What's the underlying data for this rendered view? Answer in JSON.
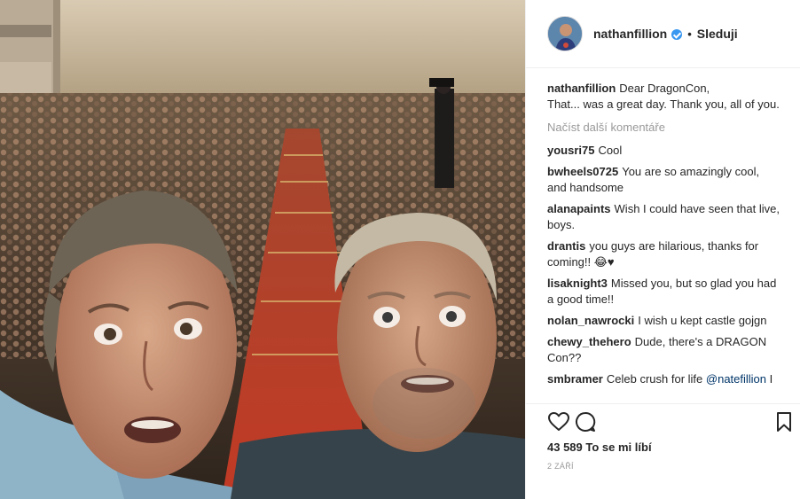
{
  "post": {
    "username": "nathanfillion",
    "verified_icon": "verified-badge-icon",
    "separator": "•",
    "follow_label": "Sleduji",
    "caption_user": "nathanfillion",
    "caption_line1": "Dear DragonCon,",
    "caption_line2": "That... was a great day. Thank you, all of you.",
    "load_more": "Načíst další komentáře",
    "comments": [
      {
        "user": "yousri75",
        "text": "Cool"
      },
      {
        "user": "bwheels0725",
        "text": "You are so amazingly cool, and handsome"
      },
      {
        "user": "alanapaints",
        "text": "Wish I could have seen that live, boys."
      },
      {
        "user": "drantis",
        "text": "you guys are hilarious, thanks for coming!! 😂♥"
      },
      {
        "user": "lisaknight3",
        "text": "Missed you, but so glad you had a good time!!"
      },
      {
        "user": "nolan_nawrocki",
        "text": "I wish u kept castle gojgn"
      },
      {
        "user": "chewy_thehero",
        "text": "Dude, there's a DRAGON Con??"
      },
      {
        "user": "smbramer",
        "text": "Celeb crush for life",
        "mention": "@natefillion",
        "tail": "I"
      }
    ],
    "likes_count": "43 589",
    "likes_label": "To se mi líbí",
    "date": "2 ZÁŘÍ"
  },
  "icons": {
    "like": "heart-icon",
    "comment": "comment-bubble-icon",
    "save": "bookmark-icon"
  },
  "colors": {
    "link_blue": "#003569",
    "verified_blue": "#3897f0",
    "muted_gray": "#999999",
    "text": "#262626"
  }
}
